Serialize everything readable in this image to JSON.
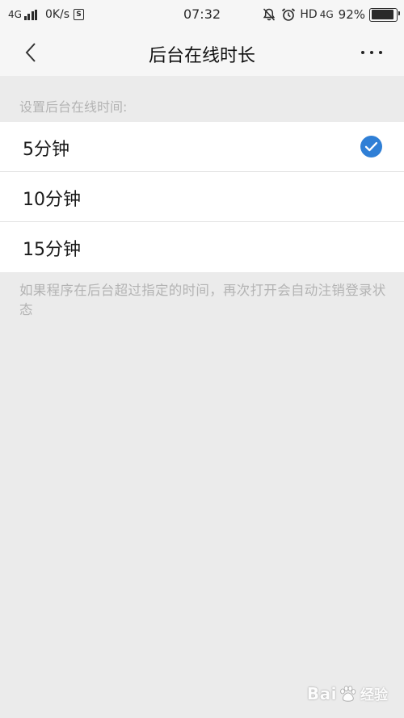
{
  "status_bar": {
    "network_left": "4G",
    "speed": "0K/s",
    "s_badge": "S",
    "time": "07:32",
    "hd": "HD",
    "network_right": "4G",
    "battery_percent": "92%",
    "battery_level": 0.92
  },
  "nav": {
    "title": "后台在线时长"
  },
  "settings": {
    "section_label": "设置后台在线时间:",
    "options": [
      {
        "label": "5分钟",
        "selected": true
      },
      {
        "label": "10分钟",
        "selected": false
      },
      {
        "label": "15分钟",
        "selected": false
      }
    ],
    "footnote": "如果程序在后台超过指定的时间，再次打开会自动注销登录状态"
  },
  "colors": {
    "accent": "#2f7fd6",
    "background": "#ebebeb",
    "hint_text": "#b3b3b3"
  },
  "watermark": {
    "brand_left": "Bai",
    "brand_right": "经验"
  }
}
